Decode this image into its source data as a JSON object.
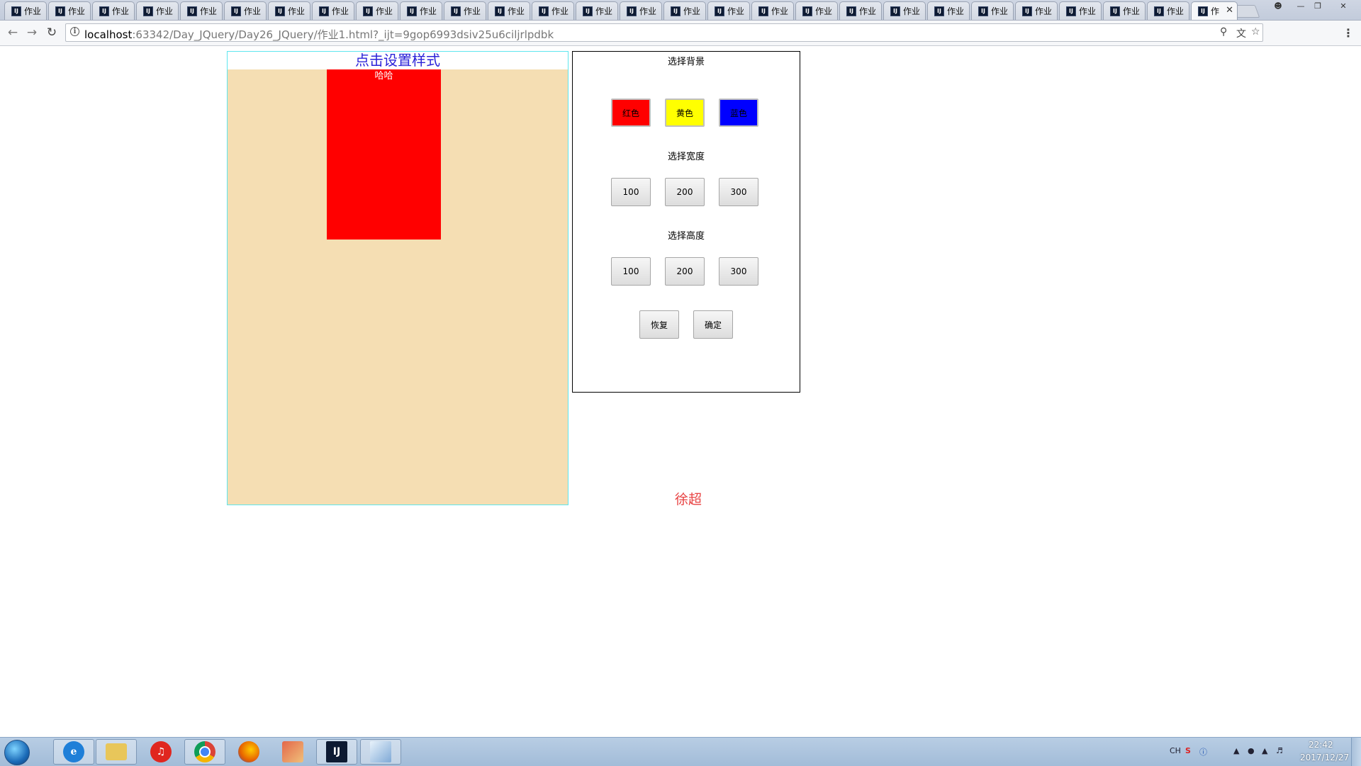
{
  "browser": {
    "tab_title": "作业",
    "tab_icon_text": "IJ",
    "tab_count": 28,
    "active_tab_title": "作",
    "close_glyph": "✕",
    "url_host": "localhost",
    "url_rest": ":63342/Day_JQuery/Day26_JQuery/作业1.html?_ijt=9gop6993dsiv25u6ciljrlpdbk"
  },
  "page": {
    "left_title": "点击设置样式",
    "box_text": "哈哈",
    "stage_color": "#f5deb3",
    "box_color": "#ff0000",
    "title_color": "#2b22d8",
    "background_section": {
      "title": "选择背景",
      "options": [
        {
          "label": "红色",
          "color": "#ff0000"
        },
        {
          "label": "黄色",
          "color": "#ffff00"
        },
        {
          "label": "蓝色",
          "color": "#0000ff"
        }
      ]
    },
    "width_section": {
      "title": "选择宽度",
      "options": [
        "100",
        "200",
        "300"
      ]
    },
    "height_section": {
      "title": "选择高度",
      "options": [
        "100",
        "200",
        "300"
      ]
    },
    "actions": {
      "reset": "恢复",
      "confirm": "确定"
    },
    "signature": "徐超"
  },
  "taskbar": {
    "apps": [
      "ie-icon",
      "explorer-icon",
      "netease-music-icon",
      "chrome-icon",
      "firefox-icon",
      "app-icon",
      "intellij-icon",
      "notepad-icon"
    ],
    "ime": "CH",
    "time": "22:42",
    "date": "2017/12/27"
  }
}
